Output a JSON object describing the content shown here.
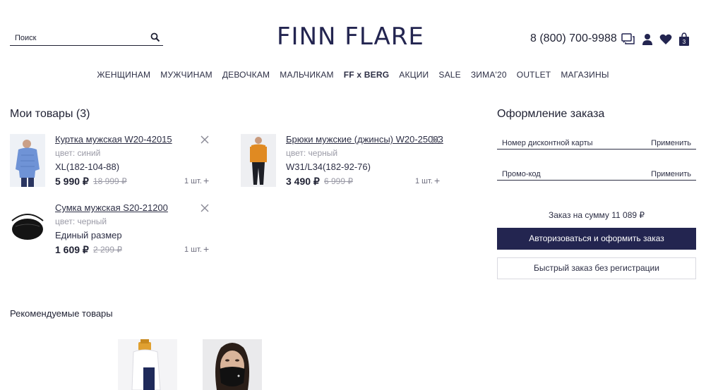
{
  "header": {
    "search_placeholder": "Поиск",
    "logo": "FINN FLARE",
    "phone": "8 (800) 700-9988",
    "icons": [
      "chat-icon",
      "user-icon",
      "heart-icon",
      "bag-icon"
    ],
    "cart_count": "3"
  },
  "nav": {
    "items": [
      "ЖЕНЩИНАМ",
      "МУЖЧИНАМ",
      "ДЕВОЧКАМ",
      "МАЛЬЧИКАМ",
      "FF x BERG",
      "АКЦИИ",
      "SALE",
      "ЗИМА'20",
      "OUTLET",
      "МАГАЗИНЫ"
    ]
  },
  "cart": {
    "title": "Мои товары (3)",
    "items": [
      {
        "name": "Куртка мужская W20-42015",
        "color": "цвет: синий",
        "size": "XL(182-104-88)",
        "price": "5 990 ₽",
        "old_price": "18 999 ₽",
        "qty": "1 шт.",
        "plus": "+"
      },
      {
        "name": "Брюки мужские (джинсы) W20-25003",
        "color": "цвет: черный",
        "size": "W31/L34(182-92-76)",
        "price": "3 490 ₽",
        "old_price": "6 999 ₽",
        "qty": "1 шт.",
        "plus": "+"
      },
      {
        "name": "Сумка мужская S20-21200",
        "color": "цвет: черный",
        "size": "Единый размер",
        "price": "1 609 ₽",
        "old_price": "2 299 ₽",
        "qty": "1 шт.",
        "plus": "+"
      }
    ]
  },
  "order": {
    "title": "Оформление заказа",
    "discount_label": "Номер дисконтной карты",
    "promo_label": "Промо-код",
    "apply_label": "Применить",
    "sum": "Заказ на сумму 11 089 ₽",
    "primary_button": "Авторизоваться и оформить заказ",
    "secondary_button": "Быстрый заказ без регистрации"
  },
  "recommended": {
    "title": "Рекомендуемые товары"
  },
  "colors": {
    "brand": "#232550",
    "text": "#1f2133",
    "muted": "#9a9aa6"
  }
}
